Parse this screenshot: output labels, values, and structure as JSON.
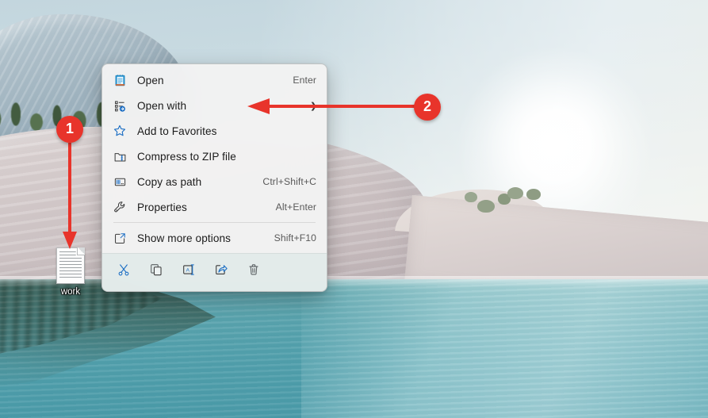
{
  "desktop": {
    "wallpaper_name": "windows-11-lake-sunrise",
    "file_icon": {
      "label": "work",
      "icon": "text-document-icon"
    }
  },
  "context_menu": {
    "items": [
      {
        "label": "Open",
        "accel": "Enter",
        "icon": "notepad-icon",
        "submenu": false
      },
      {
        "label": "Open with",
        "accel": "",
        "icon": "open-with-icon",
        "submenu": true
      },
      {
        "label": "Add to Favorites",
        "accel": "",
        "icon": "star-icon",
        "submenu": false
      },
      {
        "label": "Compress to ZIP file",
        "accel": "",
        "icon": "zip-folder-icon",
        "submenu": false
      },
      {
        "label": "Copy as path",
        "accel": "Ctrl+Shift+C",
        "icon": "copy-path-icon",
        "submenu": false
      },
      {
        "label": "Properties",
        "accel": "Alt+Enter",
        "icon": "wrench-icon",
        "submenu": false
      }
    ],
    "more_item": {
      "label": "Show more options",
      "accel": "Shift+F10",
      "icon": "show-more-options-icon"
    },
    "toolbar": [
      {
        "name": "cut",
        "icon": "scissors-icon"
      },
      {
        "name": "copy",
        "icon": "copy-icon"
      },
      {
        "name": "rename",
        "icon": "rename-icon"
      },
      {
        "name": "share",
        "icon": "share-icon"
      },
      {
        "name": "delete",
        "icon": "trash-icon"
      }
    ]
  },
  "annotations": {
    "badge_1": "1",
    "badge_2": "2",
    "color": "#e8342b"
  }
}
